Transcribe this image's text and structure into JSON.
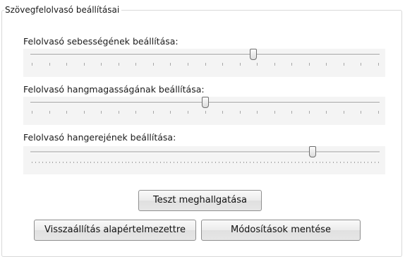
{
  "group_title": "Szövegfelolvasó beállításai",
  "sliders": [
    {
      "label": "Felolvasó sebességének beállítása:",
      "value": 0.64,
      "ticks": 21
    },
    {
      "label": "Felolvasó hangmagasságának beállítása:",
      "value": 0.5,
      "ticks": 21
    },
    {
      "label": "Felolvasó hangerejének beállítása:",
      "value": 0.81,
      "ticks": 101
    }
  ],
  "buttons": {
    "test": "Teszt meghallgatása",
    "reset": "Visszaállítás alapértelmezettre",
    "save": "Módosítások mentése"
  }
}
